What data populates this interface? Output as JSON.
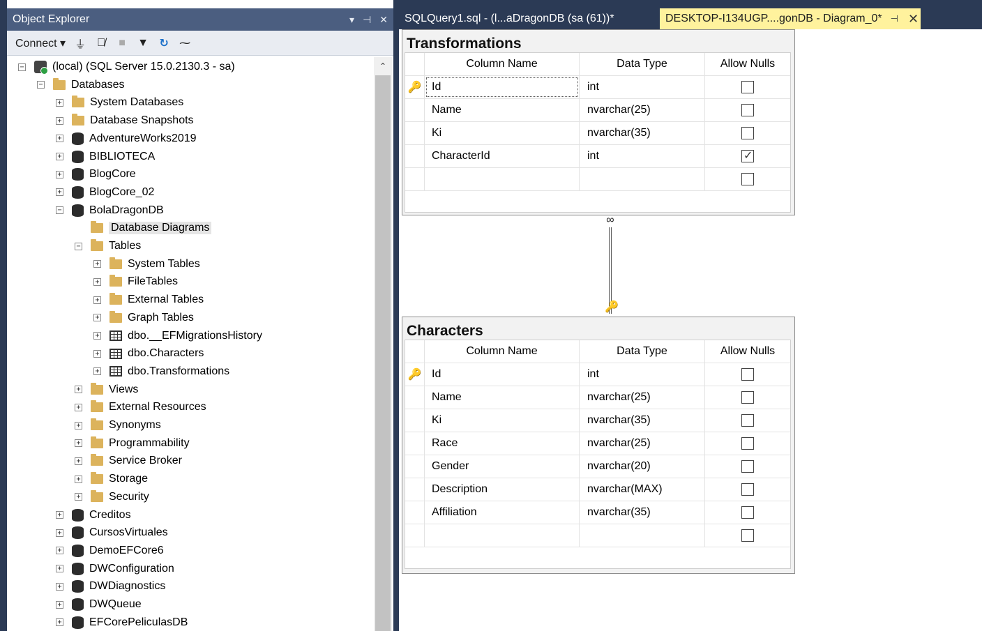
{
  "object_explorer": {
    "title": "Object Explorer",
    "title_controls": {
      "dropdown": "▾",
      "pin": "⊣",
      "close": "✕"
    },
    "toolbar": {
      "connect_label": "Connect ▾",
      "icons": [
        "connect-icon",
        "disconnect-icon",
        "stop-icon",
        "filter-icon",
        "refresh-icon",
        "activity-icon"
      ]
    },
    "tree": [
      {
        "label": "(local) (SQL Server 15.0.2130.3 - sa)",
        "icon": "server-icon",
        "level": 0,
        "exp": "−"
      },
      {
        "label": "Databases",
        "icon": "folder-icon",
        "level": 1,
        "exp": "−"
      },
      {
        "label": "System Databases",
        "icon": "folder-icon",
        "level": 2,
        "exp": "+"
      },
      {
        "label": "Database Snapshots",
        "icon": "folder-icon",
        "level": 2,
        "exp": "+"
      },
      {
        "label": "AdventureWorks2019",
        "icon": "database-icon",
        "level": 2,
        "exp": "+"
      },
      {
        "label": "BIBLIOTECA",
        "icon": "database-icon",
        "level": 2,
        "exp": "+"
      },
      {
        "label": "BlogCore",
        "icon": "database-icon",
        "level": 2,
        "exp": "+"
      },
      {
        "label": "BlogCore_02",
        "icon": "database-icon",
        "level": 2,
        "exp": "+"
      },
      {
        "label": "BolaDragonDB",
        "icon": "database-icon",
        "level": 2,
        "exp": "−"
      },
      {
        "label": "Database Diagrams",
        "icon": "folder-icon",
        "level": 3,
        "exp": "",
        "selected": true
      },
      {
        "label": "Tables",
        "icon": "folder-icon",
        "level": 3,
        "exp": "−"
      },
      {
        "label": "System Tables",
        "icon": "folder-icon",
        "level": 4,
        "exp": "+"
      },
      {
        "label": "FileTables",
        "icon": "folder-icon",
        "level": 4,
        "exp": "+"
      },
      {
        "label": "External Tables",
        "icon": "folder-icon",
        "level": 4,
        "exp": "+"
      },
      {
        "label": "Graph Tables",
        "icon": "folder-icon",
        "level": 4,
        "exp": "+"
      },
      {
        "label": "dbo.__EFMigrationsHistory",
        "icon": "table-icon",
        "level": 4,
        "exp": "+"
      },
      {
        "label": "dbo.Characters",
        "icon": "table-icon",
        "level": 4,
        "exp": "+"
      },
      {
        "label": "dbo.Transformations",
        "icon": "table-icon",
        "level": 4,
        "exp": "+"
      },
      {
        "label": "Views",
        "icon": "folder-icon",
        "level": 3,
        "exp": "+"
      },
      {
        "label": "External Resources",
        "icon": "folder-icon",
        "level": 3,
        "exp": "+"
      },
      {
        "label": "Synonyms",
        "icon": "folder-icon",
        "level": 3,
        "exp": "+"
      },
      {
        "label": "Programmability",
        "icon": "folder-icon",
        "level": 3,
        "exp": "+"
      },
      {
        "label": "Service Broker",
        "icon": "folder-icon",
        "level": 3,
        "exp": "+"
      },
      {
        "label": "Storage",
        "icon": "folder-icon",
        "level": 3,
        "exp": "+"
      },
      {
        "label": "Security",
        "icon": "folder-icon",
        "level": 3,
        "exp": "+"
      },
      {
        "label": "Creditos",
        "icon": "database-icon",
        "level": 2,
        "exp": "+"
      },
      {
        "label": "CursosVirtuales",
        "icon": "database-icon",
        "level": 2,
        "exp": "+"
      },
      {
        "label": "DemoEFCore6",
        "icon": "database-icon",
        "level": 2,
        "exp": "+"
      },
      {
        "label": "DWConfiguration",
        "icon": "database-icon",
        "level": 2,
        "exp": "+"
      },
      {
        "label": "DWDiagnostics",
        "icon": "database-icon",
        "level": 2,
        "exp": "+"
      },
      {
        "label": "DWQueue",
        "icon": "database-icon",
        "level": 2,
        "exp": "+"
      },
      {
        "label": "EFCorePeliculasDB",
        "icon": "database-icon",
        "level": 2,
        "exp": "+"
      }
    ]
  },
  "tabs": {
    "query": "SQLQuery1.sql - (l...aDragonDB (sa (61))*",
    "diagram": "DESKTOP-I134UGP....gonDB - Diagram_0*",
    "diagram_pin": "⊣",
    "diagram_close": "✕"
  },
  "diagram": {
    "headers": {
      "name": "Column Name",
      "type": "Data Type",
      "nulls": "Allow Nulls"
    },
    "tables": [
      {
        "title": "Transformations",
        "rows": [
          {
            "key": true,
            "name": "Id",
            "type": "int",
            "nulls": false,
            "focused": true
          },
          {
            "key": false,
            "name": "Name",
            "type": "nvarchar(25)",
            "nulls": false
          },
          {
            "key": false,
            "name": "Ki",
            "type": "nvarchar(35)",
            "nulls": false
          },
          {
            "key": false,
            "name": "CharacterId",
            "type": "int",
            "nulls": true
          },
          {
            "key": false,
            "name": "",
            "type": "",
            "nulls": false
          }
        ]
      },
      {
        "title": "Characters",
        "rows": [
          {
            "key": true,
            "name": "Id",
            "type": "int",
            "nulls": false
          },
          {
            "key": false,
            "name": "Name",
            "type": "nvarchar(25)",
            "nulls": false
          },
          {
            "key": false,
            "name": "Ki",
            "type": "nvarchar(35)",
            "nulls": false
          },
          {
            "key": false,
            "name": "Race",
            "type": "nvarchar(25)",
            "nulls": false
          },
          {
            "key": false,
            "name": "Gender",
            "type": "nvarchar(20)",
            "nulls": false
          },
          {
            "key": false,
            "name": "Description",
            "type": "nvarchar(MAX)",
            "nulls": false
          },
          {
            "key": false,
            "name": "Affiliation",
            "type": "nvarchar(35)",
            "nulls": false
          },
          {
            "key": false,
            "name": "",
            "type": "",
            "nulls": false
          }
        ]
      }
    ],
    "relationship": {
      "from": "Characters",
      "to": "Transformations",
      "one_symbol": "🔑",
      "many_symbol": "∞"
    }
  },
  "colors": {
    "frame": "#2b3a55",
    "oe_title": "#4b5e80",
    "active_tab": "#fff29d",
    "key": "#b8a000"
  }
}
